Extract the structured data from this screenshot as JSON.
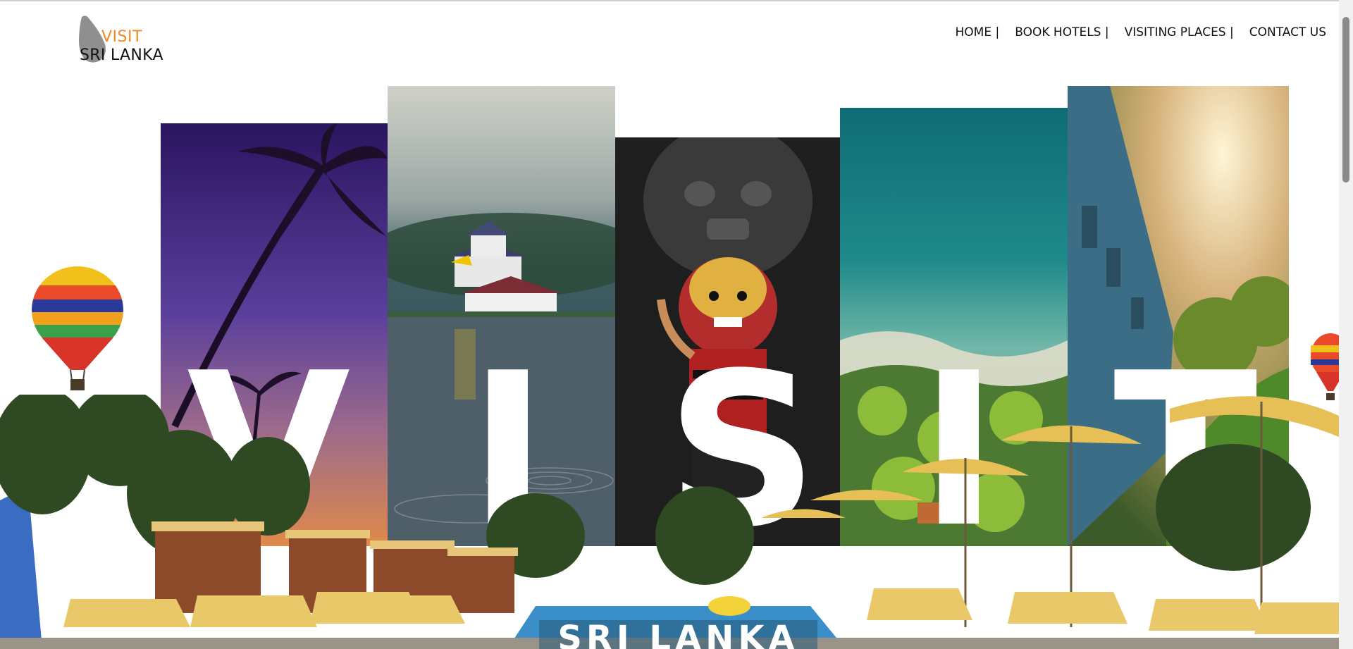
{
  "logo": {
    "line1": "VISIT",
    "line2": "SRI LANKA",
    "icon": "sri-lanka-map-icon",
    "accent_color": "#f08a24"
  },
  "nav": {
    "items": [
      {
        "label": "HOME |"
      },
      {
        "label": "BOOK HOTELS |"
      },
      {
        "label": "VISITING PLACES |"
      },
      {
        "label": "CONTACT US"
      }
    ]
  },
  "hero": {
    "letters": [
      "V",
      "I",
      "S",
      "I",
      "T"
    ],
    "subtitle": "SRI LANKA",
    "panels": [
      {
        "scene": "palm-tree-sunset"
      },
      {
        "scene": "temple-by-lake"
      },
      {
        "scene": "traditional-mask-dancer"
      },
      {
        "scene": "aerial-coastline"
      },
      {
        "scene": "train-through-hills"
      }
    ]
  }
}
